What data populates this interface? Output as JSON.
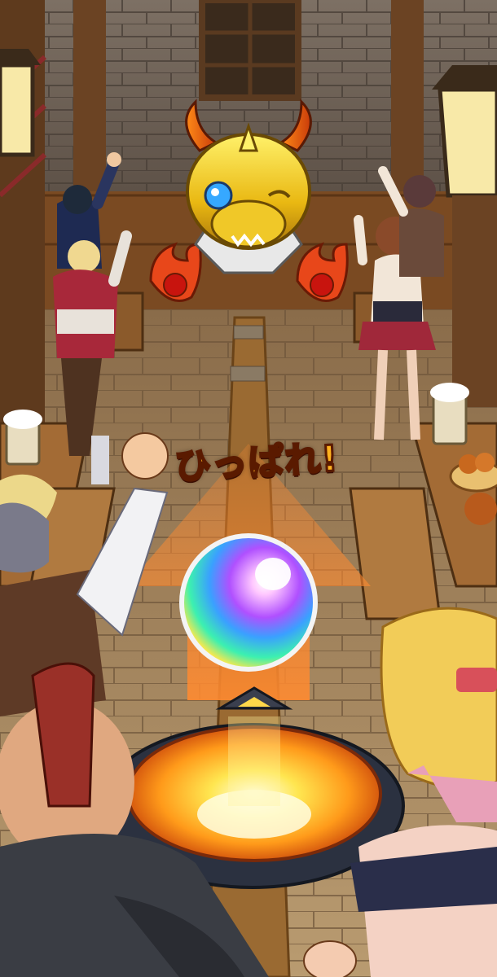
{
  "game": {
    "instruction_text": "ひっぱれ!"
  },
  "scene": {
    "icons": {
      "trophy": "golden-dragon-head-trophy",
      "orb": "rainbow-gacha-orb",
      "launch_pad": "glowing-launch-pad"
    },
    "colors": {
      "wall": "#6d6257",
      "wood": "#7a4a22",
      "floor": "#a98a63",
      "aim_arrow": "#e8742a",
      "prompt_text": "#ffb21f",
      "pad_glow": "#ffd84a"
    }
  }
}
